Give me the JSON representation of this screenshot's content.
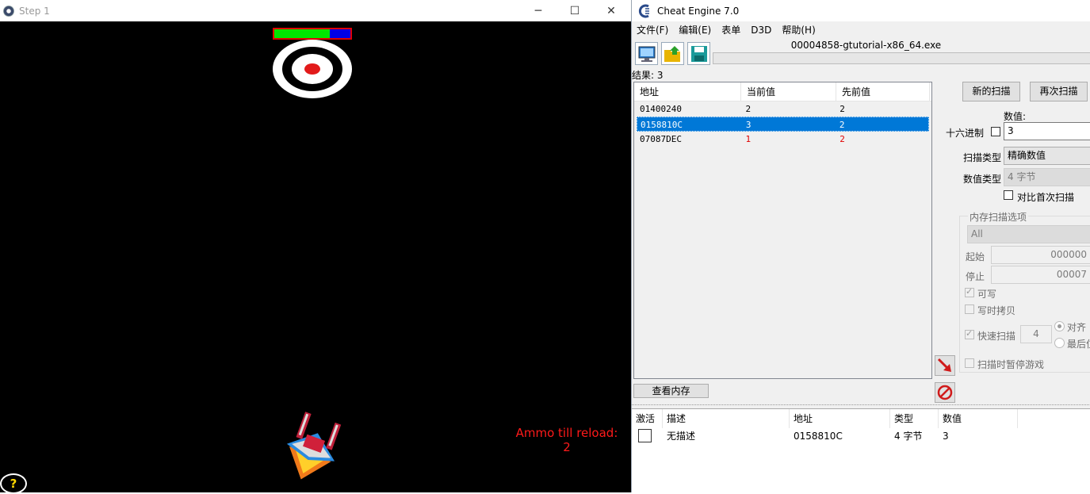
{
  "game": {
    "title": "Step 1",
    "health_fraction": 0.73,
    "ammo_label": "Ammo till reload:",
    "ammo_value": "2",
    "help_label": "?"
  },
  "ce": {
    "title": "Cheat Engine 7.0",
    "menu": [
      "文件(F)",
      "编辑(E)",
      "表单",
      "D3D",
      "帮助(H)"
    ],
    "process": "00004858-gtutorial-x86_64.exe",
    "results_label": "结果: 3",
    "results": {
      "headers": [
        "地址",
        "当前值",
        "先前值"
      ],
      "rows": [
        {
          "address": "01400240",
          "current": "2",
          "previous": "2"
        },
        {
          "address": "0158810C",
          "current": "3",
          "previous": "2"
        },
        {
          "address": "07087DEC",
          "current": "1",
          "previous": "2"
        }
      ]
    },
    "buttons": {
      "new_scan": "新的扫描",
      "next_scan": "再次扫描",
      "view_memory": "查看内存"
    },
    "value_label": "数值:",
    "hex_label": "十六进制",
    "value": "3",
    "scan_type_label": "扫描类型",
    "scan_type": "精确数值",
    "value_type_label": "数值类型",
    "value_type": "4 字节",
    "compare_first_label": "对比首次扫描",
    "mem_options_label": "内存扫描选项",
    "region": "All",
    "start_label": "起始",
    "start_value": "000000",
    "stop_label": "停止",
    "stop_value": "00007",
    "writable_label": "可写",
    "copy_on_write_label": "写时拷贝",
    "fast_scan_label": "快速扫描",
    "fast_scan_value": "4",
    "align_label": "对齐",
    "last_digits_label": "最后位",
    "pause_label": "扫描时暂停游戏",
    "addr_list": {
      "headers": [
        "激活",
        "描述",
        "地址",
        "类型",
        "数值"
      ],
      "rows": [
        {
          "description": "无描述",
          "address": "0158810C",
          "type": "4 字节",
          "value": "3"
        }
      ]
    }
  }
}
